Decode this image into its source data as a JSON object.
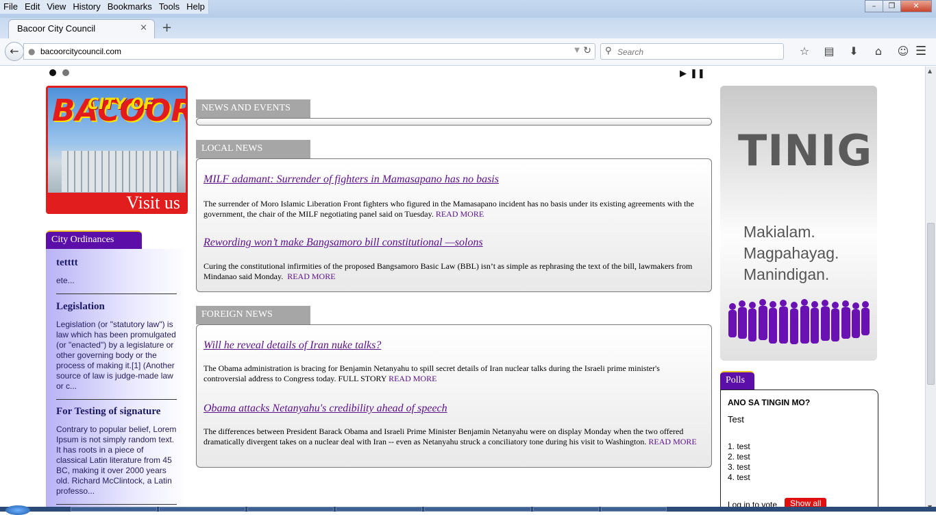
{
  "browser": {
    "menu": [
      "File",
      "Edit",
      "View",
      "History",
      "Bookmarks",
      "Tools",
      "Help"
    ],
    "window_buttons": {
      "minimize": "–",
      "maximize": "❐",
      "close": "✕"
    },
    "tab": {
      "title": "Bacoor City Council",
      "close": "×"
    },
    "new_tab": "+",
    "url": "bacoorcitycouncil.com",
    "search_placeholder": "Search"
  },
  "slider": {
    "play": "▶",
    "pause": "❚❚"
  },
  "banner": {
    "city_of": "CITY OF",
    "bacoor": "BACOOR",
    "visit": "Visit us"
  },
  "ordinances": {
    "title": "City Ordinances",
    "items": [
      {
        "title": "tetttt",
        "body": "ete..."
      },
      {
        "title": "Legislation",
        "body": "Legislation (or \"statutory law\") is law which has been promulgated (or \"enacted\") by a legislature or other governing body or the process of making it.[1] (Another source of law is judge-made law or c..."
      },
      {
        "title": "For Testing of signature",
        "body": "Contrary to popular belief, Lorem Ipsum is not simply random text. It has roots in a piece of classical Latin literature from 45 BC, making it over 2000 years old. Richard McClintock, a Latin professo..."
      }
    ]
  },
  "sections": {
    "news_events": "NEWS AND EVENTS",
    "local_news": "LOCAL NEWS",
    "foreign_news": "FOREIGN NEWS"
  },
  "local": [
    {
      "title": "MILF adamant: Surrender of fighters in Mamasapano has no basis ",
      "body": "The surrender of Moro Islamic Liberation Front fighters who figured in the Mamasapano incident has no basis under its existing agreements with the government, the chair of the MILF negotiating panel said on Tuesday.",
      "more": "READ MORE"
    },
    {
      "title": "Rewording won’t make Bangsamoro bill constitutional —solons",
      "body": "Curing the constitutional infirmities of the proposed Bangsamoro Basic Law (BBL) isn’t as simple as rephrasing the text of the bill, lawmakers from Mindanao said Monday.",
      "more": "READ MORE"
    }
  ],
  "foreign": [
    {
      "title": "Will he reveal details of Iran nuke talks?",
      "body": "The Obama administration is bracing for Benjamin Netanyahu to spill secret details of Iran nuclear talks during the Israeli prime minister's controversial address to Congress today. FULL STORY",
      "more": "READ MORE"
    },
    {
      "title": "Obama attacks Netanyahu's credibility ahead of speech",
      "body": "The differences between President Barack Obama and Israeli Prime Minister Benjamin Netanyahu were on display Monday when the two offered dramatically divergent takes on a nuclear deal with Iran -- even as Netanyahu struck a conciliatory tone during his visit to Washington.",
      "more": "READ MORE"
    }
  ],
  "tinig": {
    "title": "TINIG",
    "slogan": [
      "Makialam.",
      "Magpahayag.",
      "Manindigan."
    ]
  },
  "polls": {
    "tab": "Polls",
    "question": "ANO SA TINGIN MO?",
    "subtitle": "Test",
    "options": [
      "1. test",
      "2. test",
      "3. test",
      "4. test"
    ],
    "login": "Log in to vote",
    "show_all": "Show all"
  },
  "colors": {
    "accent_purple": "#5b0fa8",
    "banner_red": "#e21d1d",
    "link": "#5a0f8a",
    "header_gray": "#a6a6a6"
  }
}
